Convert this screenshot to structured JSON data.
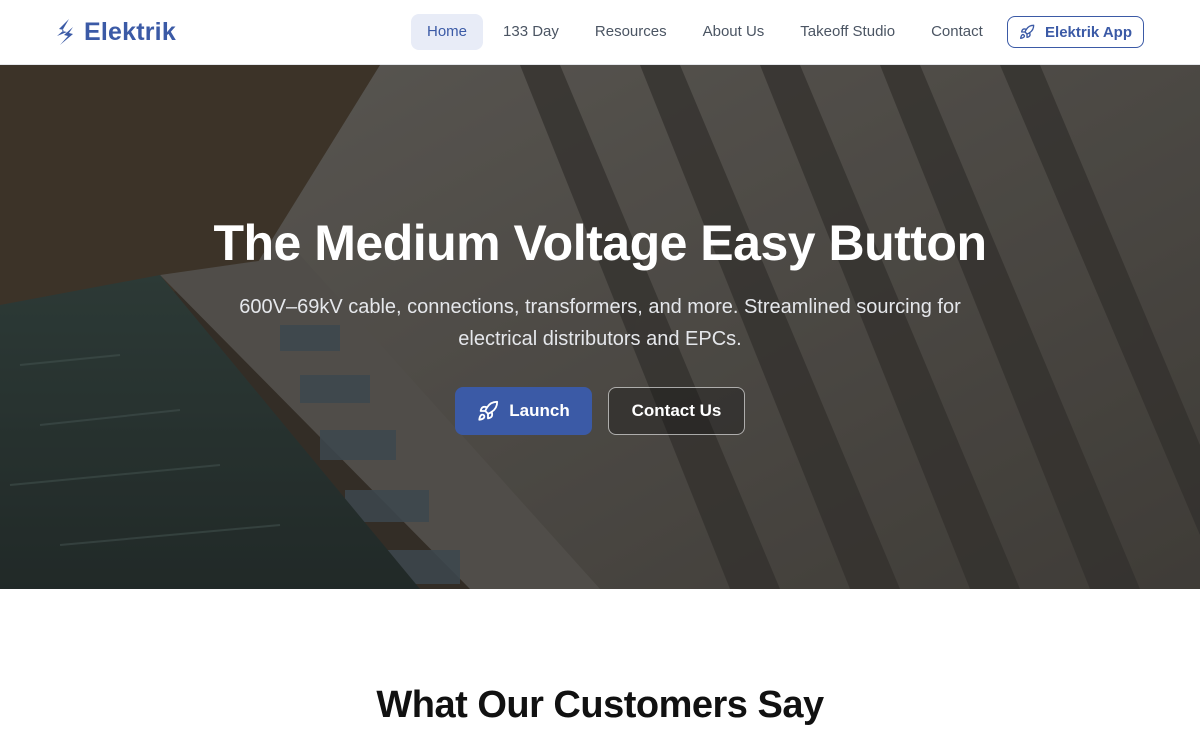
{
  "brand": {
    "name": "Elektrik",
    "logo_icon": "lightning-bolt-icon",
    "color": "#3b5aa6"
  },
  "nav": {
    "links": [
      {
        "label": "Home",
        "active": true
      },
      {
        "label": "133 Day",
        "active": false
      },
      {
        "label": "Resources",
        "active": false
      },
      {
        "label": "About Us",
        "active": false
      },
      {
        "label": "Takeoff Studio",
        "active": false
      },
      {
        "label": "Contact",
        "active": false
      }
    ],
    "app_button": {
      "label": "Elektrik App",
      "icon": "rocket-icon"
    }
  },
  "hero": {
    "title": "The Medium Voltage Easy Button",
    "subtitle": "600V–69kV cable, connections, transformers, and more. Streamlined sourcing for electrical distributors and EPCs.",
    "primary_button": {
      "label": "Launch",
      "icon": "rocket-icon"
    },
    "secondary_button": {
      "label": "Contact Us"
    }
  },
  "testimonials": {
    "title": "What Our Customers Say"
  }
}
